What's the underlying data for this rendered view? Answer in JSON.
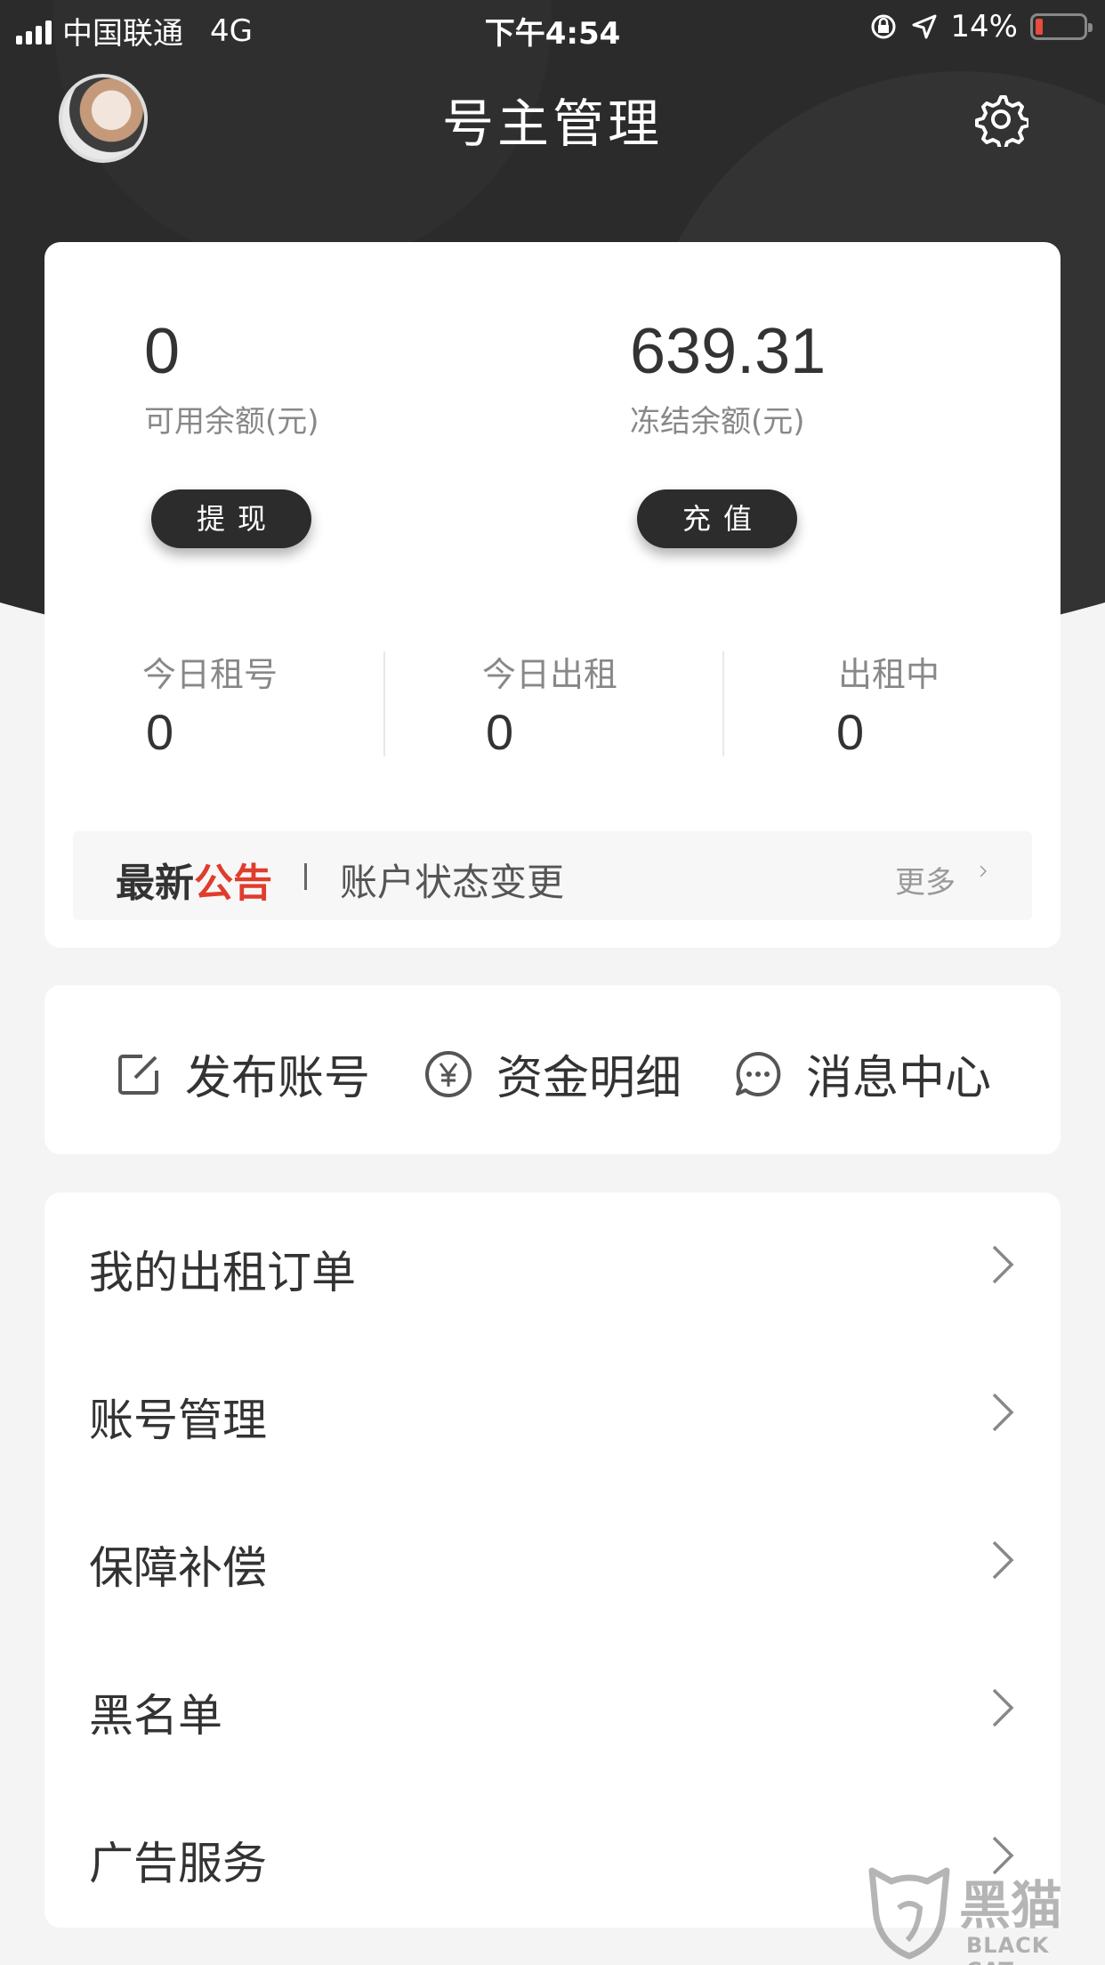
{
  "status_bar": {
    "carrier": "中国联通",
    "network": "4G",
    "time": "下午4:54",
    "battery": "14%",
    "battery_level": 0.14
  },
  "header": {
    "title": "号主管理"
  },
  "balance": {
    "available_amount": "0",
    "available_label": "可用余额(元)",
    "withdraw_label": "提现",
    "frozen_amount": "639.31",
    "frozen_label": "冻结余额(元)",
    "recharge_label": "充值"
  },
  "stats": [
    {
      "label": "今日租号",
      "value": "0"
    },
    {
      "label": "今日出租",
      "value": "0"
    },
    {
      "label": "出租中",
      "value": "0"
    }
  ],
  "notice": {
    "title_part1": "最新",
    "title_part2": "公告",
    "text": "账户状态变更",
    "more": "更多"
  },
  "actions": [
    {
      "label": "发布账号",
      "icon": "edit-icon"
    },
    {
      "label": "资金明细",
      "icon": "yuan-icon"
    },
    {
      "label": "消息中心",
      "icon": "message-icon"
    }
  ],
  "menu": [
    {
      "label": "我的出租订单"
    },
    {
      "label": "账号管理"
    },
    {
      "label": "保障补偿"
    },
    {
      "label": "黑名单"
    },
    {
      "label": "广告服务"
    }
  ],
  "watermark": {
    "text": "黑猫",
    "sub": "BLACK CAT"
  },
  "colors": {
    "header_bg": "#2b2b2b",
    "accent_red": "#e03c2d",
    "button_dark": "#2c2c2c"
  }
}
